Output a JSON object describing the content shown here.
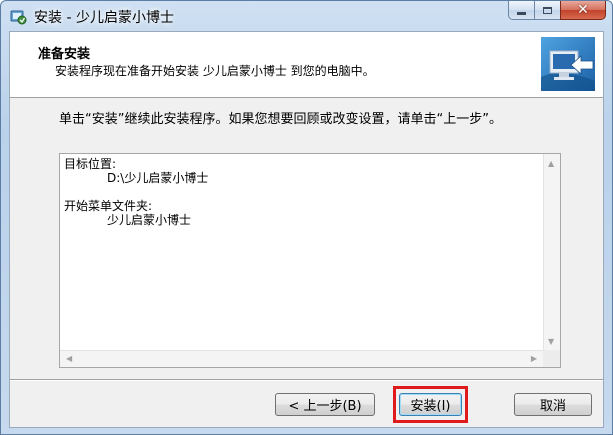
{
  "window": {
    "title": "安装 - 少儿启蒙小博士",
    "caption_buttons": [
      "minimize",
      "maximize",
      "close"
    ],
    "close_glyph": "✕"
  },
  "header": {
    "title": "准备安装",
    "subtitle": "安装程序现在准备开始安装 少儿启蒙小博士 到您的电脑中。",
    "icon": "computer-install-icon"
  },
  "instruction": "单击“安装”继续此安装程序。如果您想要回顾或改变设置，请单击“上一步”。",
  "memo": {
    "lines": [
      {
        "text": "目标位置:",
        "indent": false
      },
      {
        "text": "D:\\少儿启蒙小博士",
        "indent": true
      },
      {
        "text": "",
        "indent": false
      },
      {
        "text": "开始菜单文件夹:",
        "indent": false
      },
      {
        "text": "少儿启蒙小博士",
        "indent": true
      }
    ]
  },
  "buttons": {
    "back": "< 上一步(B)",
    "install": "安装(I)",
    "cancel": "取消"
  },
  "colors": {
    "highlight": "#e01a1a",
    "title_gradient_top": "#cfe0f2",
    "close_button": "#c2422a"
  }
}
